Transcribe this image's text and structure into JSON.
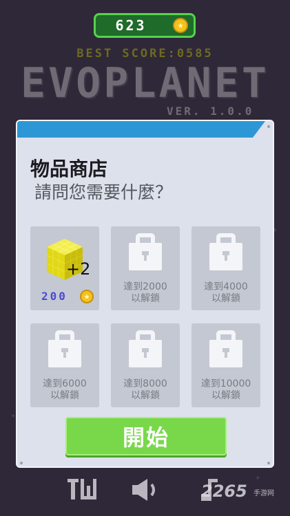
{
  "header": {
    "coins": "623",
    "best_score": "BEST SCORE:0585",
    "title": "EVOPLANET",
    "version": "VER. 1.0.0"
  },
  "shop": {
    "title": "物品商店",
    "subtitle": "請問您需要什麼？",
    "items": [
      {
        "type": "cube",
        "bonus": "+2",
        "price": "200"
      },
      {
        "type": "locked",
        "line1": "達到2000",
        "line2": "以解鎖"
      },
      {
        "type": "locked",
        "line1": "達到4000",
        "line2": "以解鎖"
      },
      {
        "type": "locked",
        "line1": "達到6000",
        "line2": "以解鎖"
      },
      {
        "type": "locked",
        "line1": "達到8000",
        "line2": "以解鎖"
      },
      {
        "type": "locked",
        "line1": "達到10000",
        "line2": "以解鎖"
      }
    ],
    "start_label": "開始"
  },
  "footer": {
    "icons": [
      "tw-icon",
      "speaker-icon",
      "music-note-icon"
    ],
    "watermark": "2265",
    "watermark_sub": "手游网"
  },
  "colors": {
    "background": "#2f2838",
    "coin_bar": "#1f6b2a",
    "panel_header": "#2d97d6",
    "start_button": "#78d84a",
    "cube": "#e6df17"
  }
}
